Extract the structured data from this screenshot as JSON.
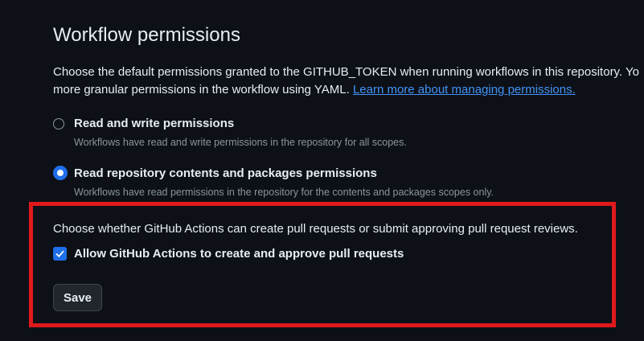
{
  "section": {
    "title": "Workflow permissions",
    "description_line1": "Choose the default permissions granted to the GITHUB_TOKEN when running workflows in this repository. Yo",
    "description_line2_prefix": "more granular permissions in the workflow using YAML. ",
    "learn_more_link": "Learn more about managing permissions."
  },
  "permissions": {
    "options": [
      {
        "label": "Read and write permissions",
        "note": "Workflows have read and write permissions in the repository for all scopes.",
        "selected": false
      },
      {
        "label": "Read repository contents and packages permissions",
        "note": "Workflows have read permissions in the repository for the contents and packages scopes only.",
        "selected": true
      }
    ]
  },
  "actions": {
    "description": "Choose whether GitHub Actions can create pull requests or submit approving pull request reviews.",
    "checkbox_label": "Allow GitHub Actions to create and approve pull requests",
    "checkbox_checked": true
  },
  "buttons": {
    "save_label": "Save"
  },
  "colors": {
    "background": "#0d1117",
    "accent": "#1f6feb",
    "link": "#4493f8",
    "highlight_border": "#e0191c"
  }
}
